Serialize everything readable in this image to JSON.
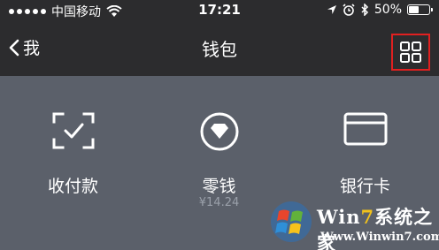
{
  "status_bar": {
    "carrier": "中国移动",
    "time": "17:21",
    "battery_text": "50%",
    "battery_level": 0.5,
    "icons": [
      "signal-icon",
      "wifi-icon",
      "location-icon",
      "alarm-icon",
      "bluetooth-icon",
      "battery-icon"
    ]
  },
  "nav": {
    "back_label": "我",
    "title": "钱包",
    "menu_icon": "grid-menu-icon",
    "highlight_color": "#e02020"
  },
  "items": [
    {
      "label": "收付款",
      "icon": "scan-pay-icon"
    },
    {
      "label": "零钱",
      "sub": "¥14.24",
      "icon": "change-wallet-icon"
    },
    {
      "label": "银行卡",
      "icon": "bank-card-icon"
    }
  ],
  "watermark": {
    "brand_prefix": "Win",
    "brand_seven": "7",
    "brand_suffix": "系统之家",
    "url": "Www.Winwin7.com"
  }
}
